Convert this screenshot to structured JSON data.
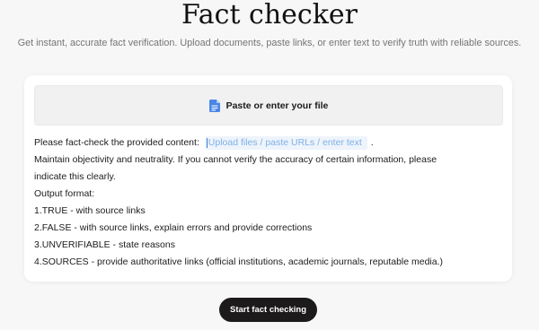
{
  "header": {
    "title": "Fact checker",
    "subtitle": "Get instant, accurate fact verification. Upload documents, paste links, or enter text to verify truth with reliable sources."
  },
  "upload": {
    "label": "Paste or enter your file",
    "icon": "document-icon",
    "icon_color": "#4a86e8"
  },
  "prompt": {
    "intro": "Please fact-check the provided content:",
    "placeholder": "Upload files / paste URLs / enter text",
    "period": ".",
    "line2": "Maintain objectivity and neutrality. If you cannot verify the accuracy of certain information, please",
    "line3": "indicate this clearly.",
    "line4": "Output format:",
    "line5": "1.TRUE - with source links",
    "line6": "2.FALSE - with source links, explain errors and provide corrections",
    "line7": "3.UNVERIFIABLE - state reasons",
    "line8": "4.SOURCES - provide authoritative links (official institutions, academic journals, reputable media.)"
  },
  "actions": {
    "start_label": "Start fact checking"
  },
  "colors": {
    "background": "#f7f7f7",
    "card": "#ffffff",
    "button": "#1c1a1a",
    "placeholder_text": "#7fb0e6",
    "placeholder_bg": "#eef4fb"
  }
}
